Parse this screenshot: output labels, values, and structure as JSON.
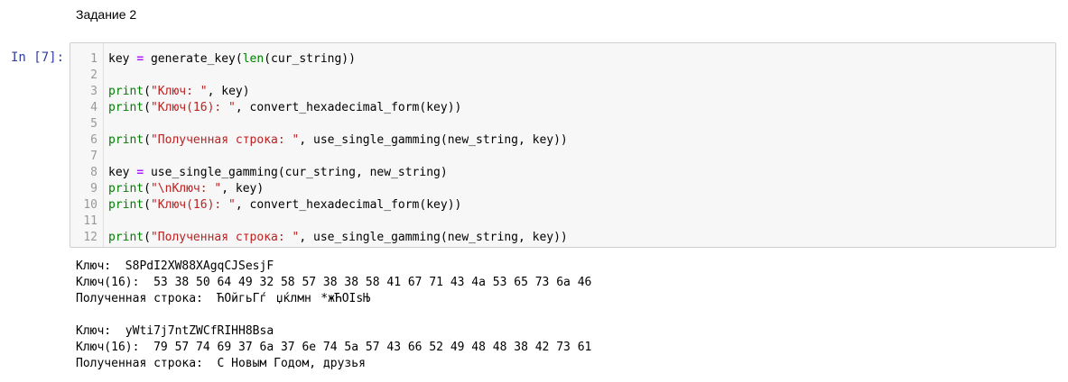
{
  "markdown": {
    "heading": "Задание 2"
  },
  "cell": {
    "prompt": "In [7]:",
    "lines": [
      {
        "n": "1",
        "segs": [
          {
            "t": "key ",
            "c": ""
          },
          {
            "t": "=",
            "c": "op"
          },
          {
            "t": " generate_key(",
            "c": ""
          },
          {
            "t": "len",
            "c": "bi"
          },
          {
            "t": "(cur_string))",
            "c": ""
          }
        ]
      },
      {
        "n": "2",
        "segs": []
      },
      {
        "n": "3",
        "segs": [
          {
            "t": "print",
            "c": "bi"
          },
          {
            "t": "(",
            "c": ""
          },
          {
            "t": "\"Ключ: \"",
            "c": "str"
          },
          {
            "t": ", key)",
            "c": ""
          }
        ]
      },
      {
        "n": "4",
        "segs": [
          {
            "t": "print",
            "c": "bi"
          },
          {
            "t": "(",
            "c": ""
          },
          {
            "t": "\"Ключ(16): \"",
            "c": "str"
          },
          {
            "t": ", convert_hexadecimal_form(key))",
            "c": ""
          }
        ]
      },
      {
        "n": "5",
        "segs": []
      },
      {
        "n": "6",
        "segs": [
          {
            "t": "print",
            "c": "bi"
          },
          {
            "t": "(",
            "c": ""
          },
          {
            "t": "\"Полученная строка: \"",
            "c": "str"
          },
          {
            "t": ", use_single_gamming(new_string, key))",
            "c": ""
          }
        ]
      },
      {
        "n": "7",
        "segs": []
      },
      {
        "n": "8",
        "segs": [
          {
            "t": "key ",
            "c": ""
          },
          {
            "t": "=",
            "c": "op"
          },
          {
            "t": " use_single_gamming(cur_string, new_string)",
            "c": ""
          }
        ]
      },
      {
        "n": "9",
        "segs": [
          {
            "t": "print",
            "c": "bi"
          },
          {
            "t": "(",
            "c": ""
          },
          {
            "t": "\"\\nКлюч: \"",
            "c": "str"
          },
          {
            "t": ", key)",
            "c": ""
          }
        ]
      },
      {
        "n": "10",
        "segs": [
          {
            "t": "print",
            "c": "bi"
          },
          {
            "t": "(",
            "c": ""
          },
          {
            "t": "\"Ключ(16): \"",
            "c": "str"
          },
          {
            "t": ", convert_hexadecimal_form(key))",
            "c": ""
          }
        ]
      },
      {
        "n": "11",
        "segs": []
      },
      {
        "n": "12",
        "segs": [
          {
            "t": "print",
            "c": "bi"
          },
          {
            "t": "(",
            "c": ""
          },
          {
            "t": "\"Полученная строка: \"",
            "c": "str"
          },
          {
            "t": ", use_single_gamming(new_string, key))",
            "c": ""
          }
        ]
      }
    ]
  },
  "output": {
    "lines": [
      "Ключ:  S8PdI2XW88XAgqCJSesjF",
      "Ключ(16):  53 38 50 64 49 32 58 57 38 38 58 41 67 71 43 4a 53 65 73 6a 46",
      "Полученная строка:  ЋОйгьГѓџќлмн*жЋОIsЊ",
      "",
      "Ключ:  yWti7j7ntZWCfRIHH8Bsa",
      "Ключ(16):  79 57 74 69 37 6a 37 6e 74 5a 57 43 66 52 49 48 48 38 42 73 61",
      "Полученная строка:  С Новым Годом, друзья"
    ]
  }
}
